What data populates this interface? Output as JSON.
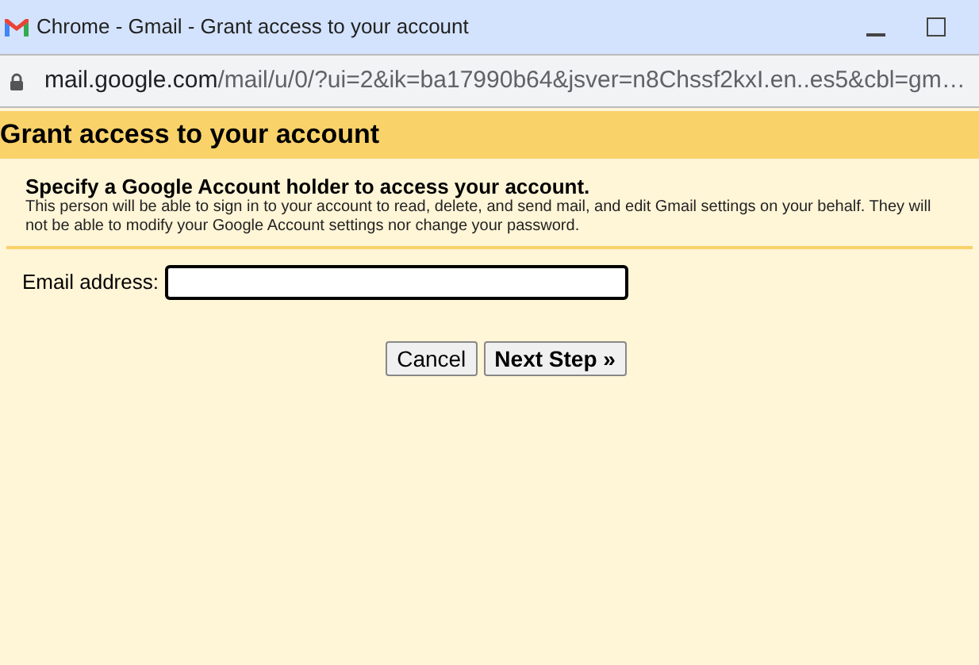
{
  "window": {
    "title": "Chrome - Gmail - Grant access to your account"
  },
  "address_bar": {
    "host": "mail.google.com",
    "path": "/mail/u/0/?ui=2&ik=ba17990b64&jsver=n8Chssf2kxI.en..es5&cbl=gm…"
  },
  "page": {
    "heading": "Grant access to your account",
    "subheading": "Specify a Google Account holder to access your account.",
    "description": "This person will be able to sign in to your account to read, delete, and send mail, and edit Gmail settings on your behalf. They will not be able to modify your Google Account settings nor change your password.",
    "email_label": "Email address:",
    "buttons": [
      {
        "label": "Cancel",
        "kind": "normal"
      },
      {
        "label": "Next Step »",
        "kind": "primary"
      }
    ]
  }
}
